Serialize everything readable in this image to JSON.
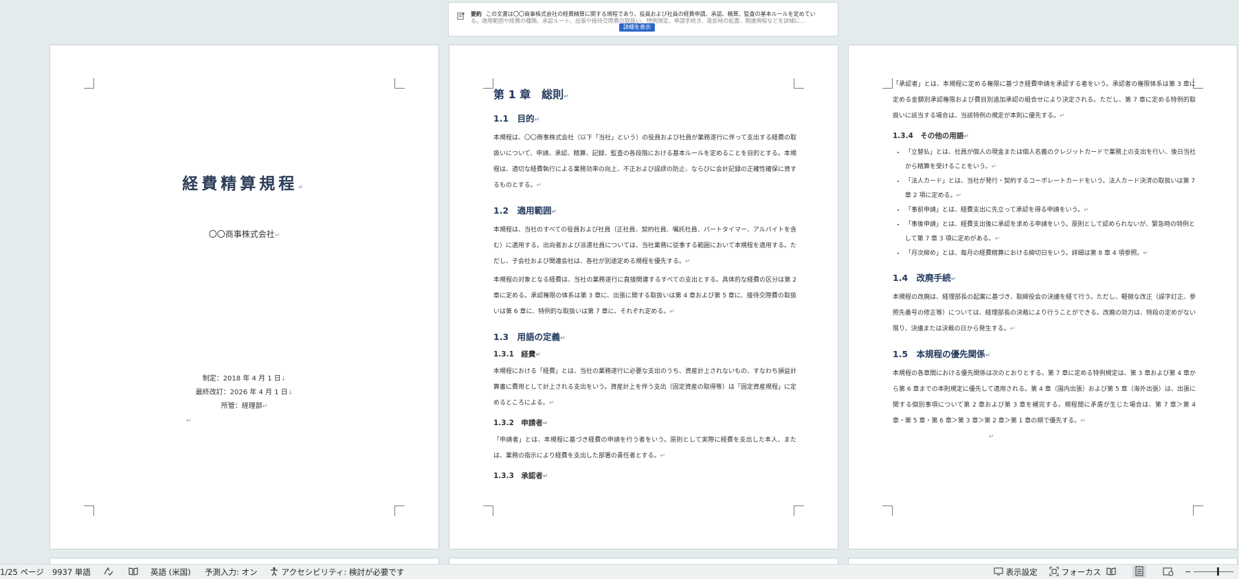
{
  "summary": {
    "title": "要約",
    "line1": "この文書は〇〇商事株式会社の経費精算に関する規程であり、役員および社員の経費申請、承認、精算、監査の基本ルールを定めてい",
    "line2": "る。適用範囲や経費の種類、承認ルート、出張や接待交際費の取扱い、特例規定、申請手続き、違反時の処置、関連規程などを詳細に…",
    "button": "詳細を表示"
  },
  "cover": {
    "title": "経費精算規程",
    "company": "〇〇商事株式会社",
    "enacted": "制定：2018 年 4 月 1 日",
    "revised": "最終改訂：2026 年 4 月 1 日",
    "owner": "所管：経理部"
  },
  "page2": {
    "chapter": "第 1 章　総則",
    "s1_1": "1.1　目的",
    "s1_1_p": "本規程は、〇〇商事株式会社（以下「当社」という）の役員および社員が業務遂行に伴って支出する経費の取扱いについて、申請、承認、精算、記録、監査の各段階における基本ルールを定めることを目的とする。本規程は、適切な経費執行による業務効率の向上、不正および誤謬の防止、ならびに会計記録の正確性確保に資するものとする。",
    "s1_2": "1.2　適用範囲",
    "s1_2_p1": "本規程は、当社のすべての役員および社員（正社員、契約社員、嘱託社員、パートタイマー、アルバイトを含む）に適用する。出向者および派遣社員については、当社業務に従事する範囲において本規程を適用する。ただし、子会社および関連会社は、各社が別途定める規程を優先する。",
    "s1_2_p2": "本規程の対象となる経費は、当社の業務遂行に直接関連するすべての支出とする。具体的な経費の区分は第 2 章に定める。承認権限の体系は第 3 章に、出張に関する取扱いは第 4 章および第 5 章に、接待交際費の取扱いは第 6 章に、特例的な取扱いは第 7 章に、それぞれ定める。",
    "s1_3": "1.3　用語の定義",
    "s1_3_1": "1.3.1　経費",
    "s1_3_1_p": "本規程における「経費」とは、当社の業務遂行に必要な支出のうち、資産計上されないもの、すなわち損益計算書に費用として計上される支出をいう。資産計上を伴う支出（固定資産の取得等）は「固定資産規程」に定めるところによる。",
    "s1_3_2": "1.3.2　申請者",
    "s1_3_2_p": "「申請者」とは、本規程に基づき経費の申請を行う者をいう。原則として実際に経費を支出した本人、または、業務の指示により経費を支出した部署の責任者とする。",
    "s1_3_3": "1.3.3　承認者"
  },
  "page3": {
    "p_top": "「承認者」とは、本規程に定める権限に基づき経費申請を承認する者をいう。承認者の権限体系は第 3 章に定める金額別承認権限および費目別追加承認の組合せにより決定される。ただし、第 7 章に定める特例的取扱いに該当する場合は、当該特例の規定が本則に優先する。",
    "s1_3_4": "1.3.4　その他の用語",
    "bullets": [
      "「立替払」とは、社員が個人の現金または個人名義のクレジットカードで業務上の支出を行い、後日当社から精算を受けることをいう。",
      "「法人カード」とは、当社が発行・契約するコーポレートカードをいう。法人カード決済の取扱いは第 7 章 2 項に定める。",
      "「事前申請」とは、経費支出に先立って承認を得る申請をいう。",
      "「事後申請」とは、経費支出後に承認を求める申請をいう。原則として認められないが、緊急時の特例として第 7 章 3 項に定めがある。",
      "「月次締め」とは、毎月の経費精算における締切日をいう。詳細は第 8 章 4 項参照。"
    ],
    "s1_4": "1.4　改廃手続",
    "s1_4_p": "本規程の改廃は、経理部長の起案に基づき、取締役会の決議を経て行う。ただし、軽微な改正（誤字訂正、参照先番号の修正等）については、経理部長の決裁により行うことができる。改廃の効力は、特段の定めがない限り、決議または決裁の日から発生する。",
    "s1_5": "1.5　本規程の優先関係",
    "s1_5_p": "本規程の各章間における優先関係は次のとおりとする。第 7 章に定める特例規定は、第 3 章および第 4 章から第 6 章までの本則規定に優先して適用される。第 4 章（国内出張）および第 5 章（海外出張）は、出張に関する個別事項について第 2 章および第 3 章を補完する。規程間に矛盾が生じた場合は、第 7 章＞第 4 章・第 5 章・第 6 章＞第 3 章＞第 2 章＞第 1 章の順で優先する。"
  },
  "statusbar": {
    "page": "1/25 ページ",
    "words": "9937 単語",
    "language": "英語 (米国)",
    "predictive": "予測入力: オン",
    "accessibility": "アクセシビリティ: 検討が必要です",
    "display": "表示設定",
    "focus": "フォーカス"
  },
  "icons": {
    "paragraph_mark": "↵",
    "line_break": "↓"
  }
}
